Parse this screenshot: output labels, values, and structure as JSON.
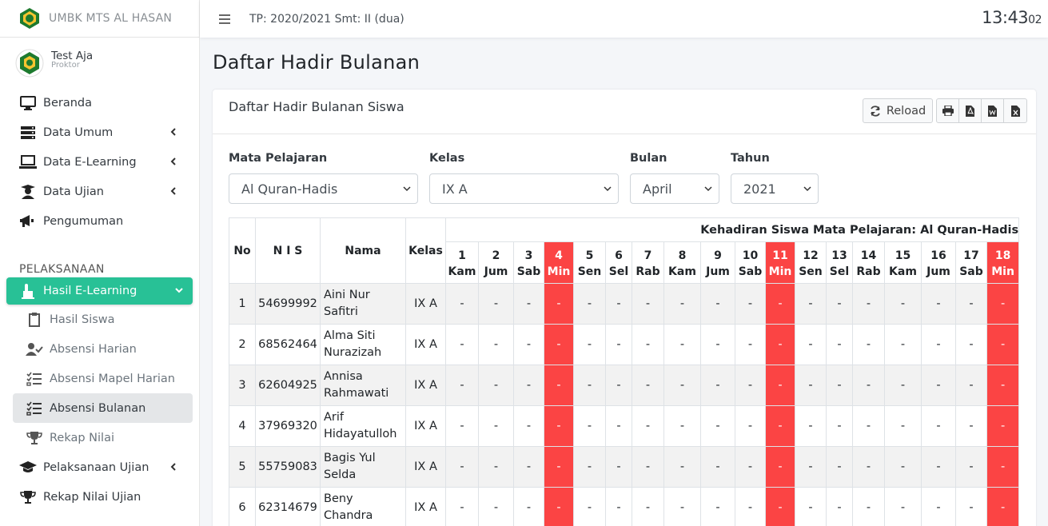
{
  "brand": {
    "name": "UMBK MTS AL HASAN"
  },
  "user": {
    "name": "Test Aja",
    "role": "Proktor"
  },
  "topbar": {
    "period": "TP: 2020/2021 Smt: II (dua)",
    "clock_hm": "13:43",
    "clock_sec": "02"
  },
  "sidebar": {
    "items": [
      {
        "label": "Beranda",
        "icon": "desktop-icon"
      },
      {
        "label": "Data Umum",
        "icon": "server-icon"
      },
      {
        "label": "Data E-Learning",
        "icon": "laptop-icon"
      },
      {
        "label": "Data Ujian",
        "icon": "user-graduate-icon"
      },
      {
        "label": "Pengumuman",
        "icon": "bullhorn-icon"
      }
    ],
    "section_header": "PELAKSANAAN",
    "active": {
      "label": "Hasil E-Learning",
      "icon": "hand-point-icon"
    },
    "subitems": [
      {
        "label": "Hasil Siswa",
        "icon": "clipboard-icon"
      },
      {
        "label": "Absensi Harian",
        "icon": "user-check-icon"
      },
      {
        "label": "Absensi Mapel Harian",
        "icon": "tasks-icon"
      },
      {
        "label": "Absensi Bulanan",
        "icon": "tasks-icon"
      },
      {
        "label": "Rekap Nilai",
        "icon": "trophy-icon"
      }
    ],
    "bottom_items": [
      {
        "label": "Pelaksanaan Ujian",
        "icon": "graduation-cap-icon"
      },
      {
        "label": "Rekap Nilai Ujian",
        "icon": "trophy-icon"
      }
    ]
  },
  "page": {
    "title": "Daftar Hadir Bulanan"
  },
  "card": {
    "title": "Daftar Hadir Bulanan Siswa",
    "reload_label": "Reload"
  },
  "filters": {
    "mapel_label": "Mata Pelajaran",
    "mapel_value": "Al Quran-Hadis",
    "kelas_label": "Kelas",
    "kelas_value": "IX A",
    "bulan_label": "Bulan",
    "bulan_value": "April",
    "tahun_label": "Tahun",
    "tahun_value": "2021"
  },
  "table": {
    "headers": {
      "no": "No",
      "nis": "N I S",
      "nama": "Nama",
      "kelas": "Kelas"
    },
    "banner": "Kehadiran Siswa Mata Pelajaran: Al Quran-Hadis",
    "days": [
      {
        "d": "1",
        "w": "Kam",
        "holiday": false
      },
      {
        "d": "2",
        "w": "Jum",
        "holiday": false
      },
      {
        "d": "3",
        "w": "Sab",
        "holiday": false
      },
      {
        "d": "4",
        "w": "Min",
        "holiday": true
      },
      {
        "d": "5",
        "w": "Sen",
        "holiday": false
      },
      {
        "d": "6",
        "w": "Sel",
        "holiday": false
      },
      {
        "d": "7",
        "w": "Rab",
        "holiday": false
      },
      {
        "d": "8",
        "w": "Kam",
        "holiday": false
      },
      {
        "d": "9",
        "w": "Jum",
        "holiday": false
      },
      {
        "d": "10",
        "w": "Sab",
        "holiday": false
      },
      {
        "d": "11",
        "w": "Min",
        "holiday": true
      },
      {
        "d": "12",
        "w": "Sen",
        "holiday": false
      },
      {
        "d": "13",
        "w": "Sel",
        "holiday": false
      },
      {
        "d": "14",
        "w": "Rab",
        "holiday": false
      },
      {
        "d": "15",
        "w": "Kam",
        "holiday": false
      },
      {
        "d": "16",
        "w": "Jum",
        "holiday": false
      },
      {
        "d": "17",
        "w": "Sab",
        "holiday": false
      },
      {
        "d": "18",
        "w": "Min",
        "holiday": true
      }
    ],
    "empty_mark": "-",
    "rows": [
      {
        "no": "1",
        "nis": "54699992",
        "nama": "Aini Nur Safitri",
        "kelas": "IX A"
      },
      {
        "no": "2",
        "nis": "68562464",
        "nama": "Alma Siti Nurazizah",
        "kelas": "IX A"
      },
      {
        "no": "3",
        "nis": "62604925",
        "nama": "Annisa Rahmawati",
        "kelas": "IX A"
      },
      {
        "no": "4",
        "nis": "37969320",
        "nama": "Arif Hidayatulloh",
        "kelas": "IX A"
      },
      {
        "no": "5",
        "nis": "55759083",
        "nama": "Bagis Yul Selda",
        "kelas": "IX A"
      },
      {
        "no": "6",
        "nis": "62314679",
        "nama": "Beny Chandra",
        "kelas": "IX A"
      }
    ]
  },
  "colors": {
    "accent": "#28c196",
    "holiday": "#fb4444"
  }
}
